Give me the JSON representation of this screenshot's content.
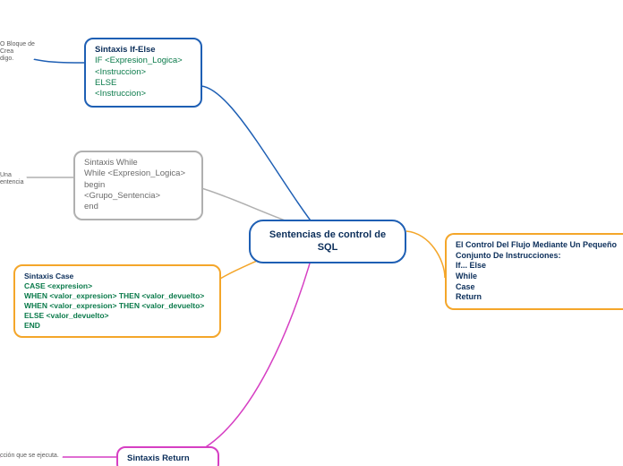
{
  "center": {
    "title": "Sentencias de control de SQL"
  },
  "ifelse": {
    "title": "Sintaxis If-Else",
    "l1": "IF <Expresion_Logica>",
    "l2": " <Instruccion>",
    "l3": "ELSE",
    "l4": " <Instruccion>"
  },
  "while": {
    "title": "Sintaxis While",
    "l1": "While <Expresion_Logica>",
    "l2": " begin",
    "l3": " <Grupo_Sentencia>",
    "l4": " end"
  },
  "case": {
    "title": "Sintaxis Case",
    "l1": "CASE <expresion>",
    "l2": " WHEN <valor_expresion> THEN <valor_devuelto>",
    "l3": " WHEN <valor_expresion> THEN <valor_devuelto>",
    "l4": " ELSE <valor_devuelto>",
    "l5": " END"
  },
  "return": {
    "title": "Sintaxis Return"
  },
  "control": {
    "l1": "El Control Del Flujo Mediante Un Pequeño",
    "l2": "Conjunto De Instrucciones:",
    "l3": "If... Else",
    "l4": "While",
    "l5": "Case",
    "l6": "Return"
  },
  "edge_ifelse": {
    "l1": "O Bloque de",
    "l2": "Crea",
    "l3": "digo."
  },
  "edge_while": {
    "l1": "Una",
    "l2": "entencia"
  },
  "edge_return": {
    "l1": "cción que se ejecuta."
  },
  "colors": {
    "blue": "#1e5fb4",
    "gray": "#b0b0b0",
    "orange": "#f4a62a",
    "magenta": "#d63fc3"
  }
}
